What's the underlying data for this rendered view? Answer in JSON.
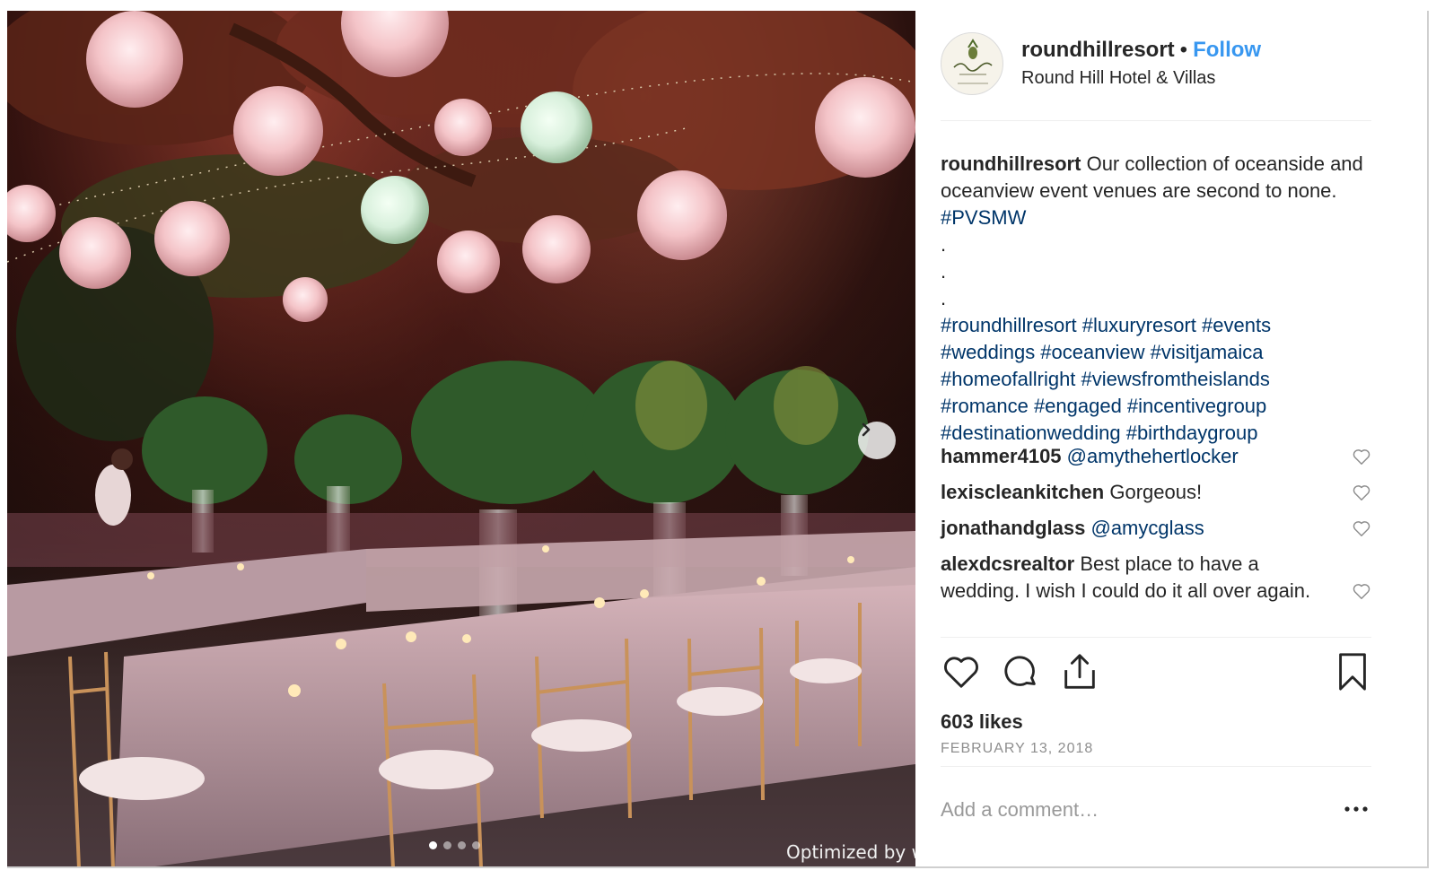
{
  "post": {
    "username": "roundhillresort",
    "separator": "•",
    "follow_label": "Follow",
    "location": "Round Hill Hotel & Villas",
    "watermark": "Optimized by w",
    "carousel": {
      "count": 4,
      "active": 0
    }
  },
  "caption": {
    "username": "roundhillresort",
    "text": "Our collection of oceanside and oceanview event venues are second to none.",
    "first_tag": "#PVSMW",
    "dot": ".",
    "tag_lines": [
      "#roundhillresort #luxuryresort #events",
      "#weddings #oceanview #visitjamaica",
      "#homeofallright #viewsfromtheislands",
      "#romance #engaged #incentivegroup",
      "#destinationwedding #birthdaygroup"
    ]
  },
  "comments": [
    {
      "user": "hammer4105",
      "text": "@amythehertlocker",
      "is_mention": true
    },
    {
      "user": "lexiscleankitchen",
      "text": "Gorgeous!",
      "is_mention": false
    },
    {
      "user": "jonathandglass",
      "text": "@amycglass",
      "is_mention": true
    },
    {
      "user": "alexdcsrealtor",
      "text": "Best place to have a wedding. I wish I could do it all over again.",
      "is_mention": false
    }
  ],
  "stats": {
    "likes": "603 likes",
    "date": "FEBRUARY 13, 2018"
  },
  "comment_box": {
    "placeholder": "Add a comment…"
  },
  "icons": [
    "avatar-logo",
    "chevron-right-icon",
    "heart-icon",
    "comment-icon",
    "share-icon",
    "bookmark-icon",
    "more-icon",
    "small-heart-icon"
  ],
  "colors": {
    "link_blue": "#3897f0",
    "hashtag": "#003569",
    "muted": "#8e8e8e",
    "divider": "#efefef"
  }
}
